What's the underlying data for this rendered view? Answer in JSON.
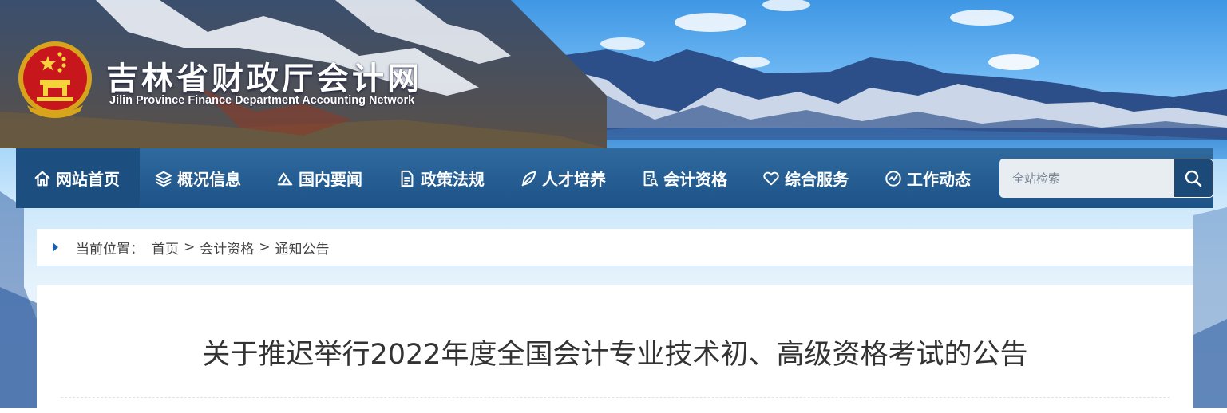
{
  "header": {
    "site_title": "吉林省财政厅会计网",
    "site_subtitle": "Jilin Province Finance Department Accounting Network"
  },
  "nav": {
    "items": [
      {
        "label": "网站首页",
        "icon": "home-icon"
      },
      {
        "label": "概况信息",
        "icon": "layers-icon"
      },
      {
        "label": "国内要闻",
        "icon": "news-icon"
      },
      {
        "label": "政策法规",
        "icon": "document-icon"
      },
      {
        "label": "人才培养",
        "icon": "leaf-icon"
      },
      {
        "label": "会计资格",
        "icon": "certificate-icon"
      },
      {
        "label": "综合服务",
        "icon": "heart-icon"
      },
      {
        "label": "工作动态",
        "icon": "activity-icon"
      }
    ],
    "active_index": 0
  },
  "search": {
    "placeholder": "全站检索",
    "button_icon": "search-icon"
  },
  "breadcrumb": {
    "prefix": "当前位置：",
    "items": [
      "首页",
      "会计资格",
      "通知公告"
    ],
    "separator": ">"
  },
  "article": {
    "title": "关于推迟举行2022年度全国会计专业技术初、高级资格考试的公告"
  },
  "colors": {
    "nav_bg": "#235b90",
    "nav_active_bg": "#1c4e80",
    "crumb_arrow": "#1d5ea6",
    "title_text": "#333333"
  }
}
